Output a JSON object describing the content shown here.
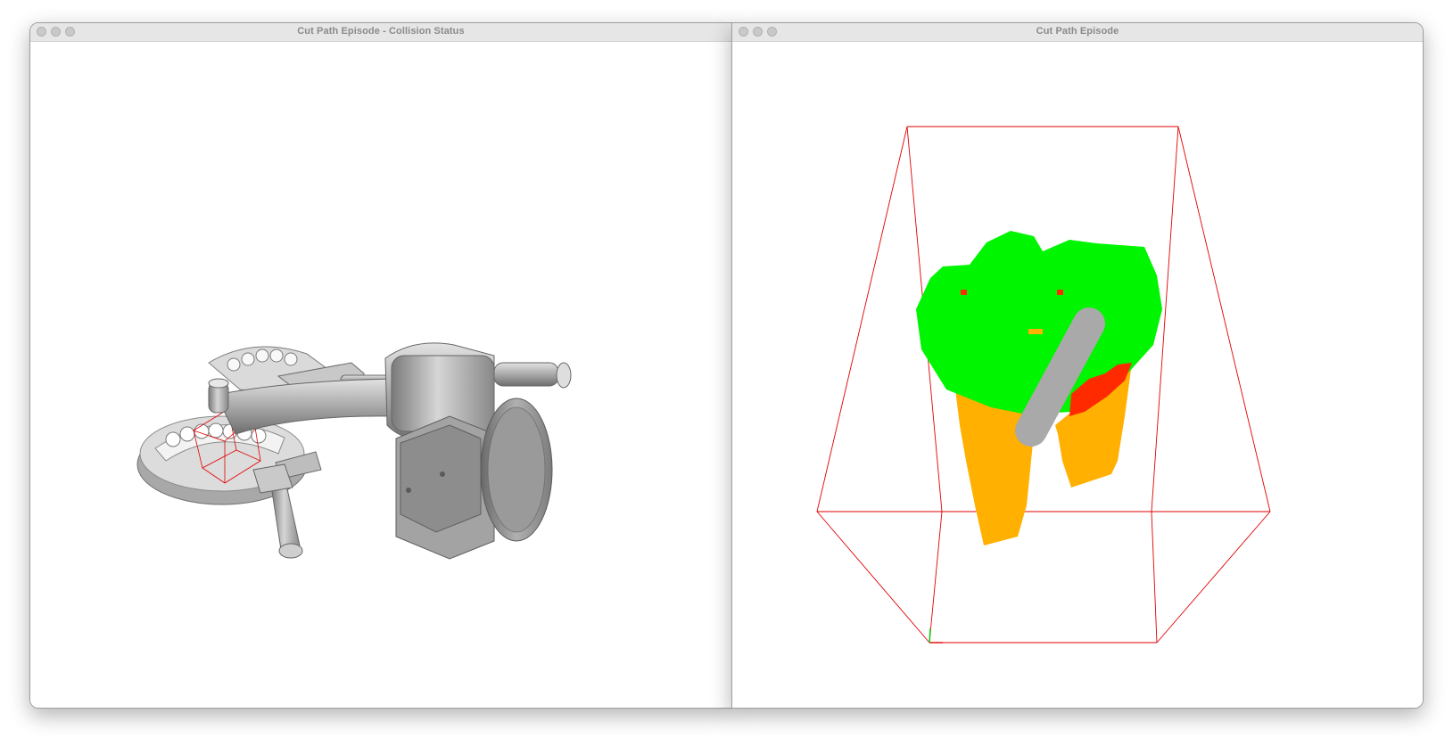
{
  "windows": [
    {
      "title": "Cut Path Episode - Collision Status"
    },
    {
      "title": "Cut Path Episode"
    }
  ],
  "colors": {
    "uncut": "#00f500",
    "cut_region": "#ffb000",
    "collision": "#ff2a00",
    "bounding_box": "#e00000",
    "tool": "#a9a9a9",
    "model_gray": "#b8b8b8"
  }
}
